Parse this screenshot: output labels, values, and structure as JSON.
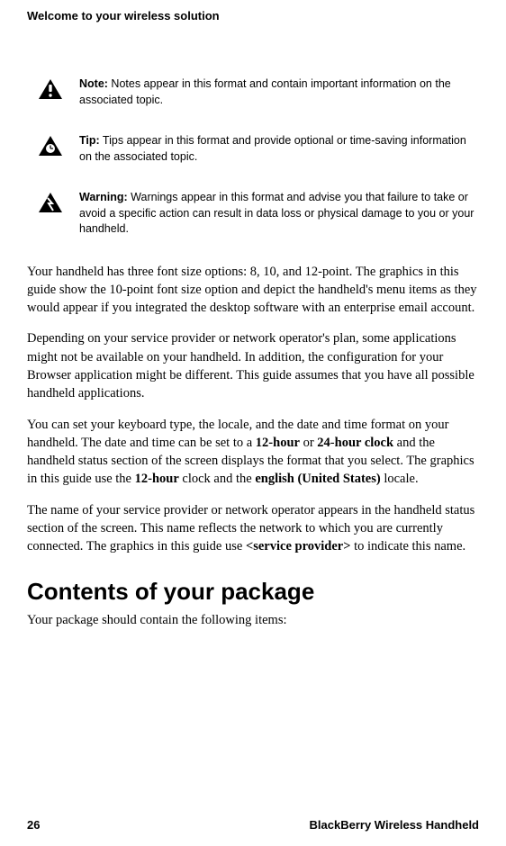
{
  "header": {
    "title": "Welcome to your wireless solution"
  },
  "callouts": {
    "note": {
      "label": "Note:",
      "text": " Notes appear in this format and contain important information on the associated topic."
    },
    "tip": {
      "label": "Tip:",
      "text": " Tips appear in this format and provide optional or time-saving information on the associated topic."
    },
    "warning": {
      "label": "Warning:",
      "text": " Warnings appear in this format and advise you that failure to take or avoid a specific action can result in data loss or physical damage to you or your handheld."
    }
  },
  "paragraphs": {
    "p1": "Your handheld has three font size options: 8, 10, and 12-point. The graphics in this guide show the 10-point font size option and depict the handheld's menu items as they would appear if you integrated the desktop software with an enterprise email account.",
    "p2": "Depending on your service provider or network operator's plan, some applications might not be available on your handheld. In addition, the configuration for your Browser application might be different. This guide assumes that you have all possible handheld applications.",
    "p3_parts": {
      "a": "You can set your keyboard type, the locale, and the date and time format on your handheld. The date and time can be set to a ",
      "b": "12-hour",
      "c": " or ",
      "d": "24",
      "e": "-",
      "f": "hour clock",
      "g": " and the handheld status section of the screen displays the format that you select. The graphics in this guide use the ",
      "h": "12-hour",
      "i": " clock and the ",
      "j": "english (United States)",
      "k": " locale."
    },
    "p4_parts": {
      "a": "The name of your service provider or network operator appears in the handheld status section of the screen. This name reflects the network to which you are currently connected. The graphics in this guide use ",
      "b": "<service provider>",
      "c": " to indicate this name."
    },
    "p5": "Your package should contain the following items:"
  },
  "heading": "Contents of your package",
  "footer": {
    "page": "26",
    "product": "BlackBerry Wireless Handheld"
  }
}
